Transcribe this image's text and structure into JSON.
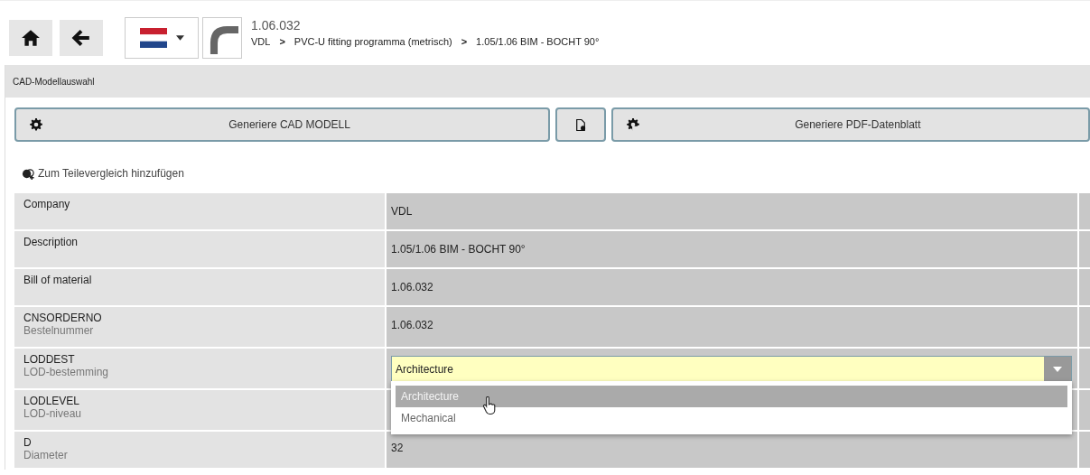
{
  "header": {
    "part_number": "1.06.032",
    "breadcrumb": [
      "VDL",
      "PVC-U fitting programma (metrisch)",
      "1.05/1.06 BIM - BOCHT 90°"
    ],
    "separator": ">"
  },
  "panel": {
    "title": "CAD-Modellauswahl"
  },
  "actions": [
    {
      "kind": "wide",
      "label": "Generiere CAD MODELL"
    },
    {
      "kind": "icon"
    },
    {
      "kind": "wide",
      "label": "Generiere PDF-Datenblatt"
    }
  ],
  "compare_link": "Zum Teilevergleich hinzufügen",
  "rows": [
    {
      "kind": "text",
      "label": "Company",
      "value": "VDL"
    },
    {
      "kind": "text",
      "label": "Description",
      "value": "1.05/1.06 BIM - BOCHT 90°"
    },
    {
      "kind": "text",
      "label": "Bill of material",
      "value": "1.06.032"
    },
    {
      "kind": "text",
      "label": "CNSORDERNO",
      "sublabel": "Bestelnummer",
      "value": "1.06.032"
    },
    {
      "kind": "select",
      "label": "LODDEST",
      "sublabel": "LOD-bestemming",
      "value": "Architecture",
      "expanded": true,
      "options": [
        {
          "label": "Architecture",
          "selected": true
        },
        {
          "label": "Mechanical",
          "selected": false
        }
      ]
    },
    {
      "kind": "hidden",
      "label": "LODLEVEL",
      "sublabel": "LOD-niveau"
    },
    {
      "kind": "text",
      "label": "D",
      "sublabel": "Diameter",
      "value": "32"
    }
  ]
}
